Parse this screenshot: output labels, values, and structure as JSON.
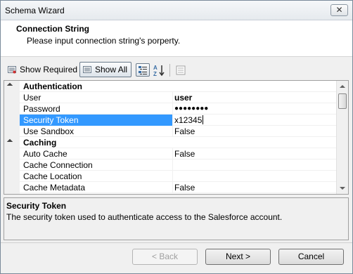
{
  "window": {
    "title": "Schema Wizard"
  },
  "header": {
    "title": "Connection String",
    "subtitle": "Please input connection string's porperty."
  },
  "toolbar": {
    "show_required": "Show Required",
    "show_all": "Show All"
  },
  "grid": {
    "rows": [
      {
        "type": "category",
        "name": "Authentication"
      },
      {
        "type": "property",
        "name": "User",
        "value": "user",
        "bold": true
      },
      {
        "type": "property",
        "name": "Password",
        "value": "●●●●●●●●",
        "bold": true
      },
      {
        "type": "property",
        "name": "Security Token",
        "value": "x12345",
        "selected": true
      },
      {
        "type": "property",
        "name": "Use Sandbox",
        "value": "False"
      },
      {
        "type": "category",
        "name": "Caching"
      },
      {
        "type": "property",
        "name": "Auto Cache",
        "value": "False"
      },
      {
        "type": "property",
        "name": "Cache Connection",
        "value": ""
      },
      {
        "type": "property",
        "name": "Cache Location",
        "value": ""
      },
      {
        "type": "property",
        "name": "Cache Metadata",
        "value": "False"
      }
    ]
  },
  "description": {
    "title": "Security Token",
    "text": "The security token used to authenticate access to the Salesforce account."
  },
  "buttons": {
    "back": "< Back",
    "next": "Next >",
    "cancel": "Cancel"
  },
  "colors": {
    "selection": "#3399ff",
    "window_bg": "#f0f0f0"
  }
}
